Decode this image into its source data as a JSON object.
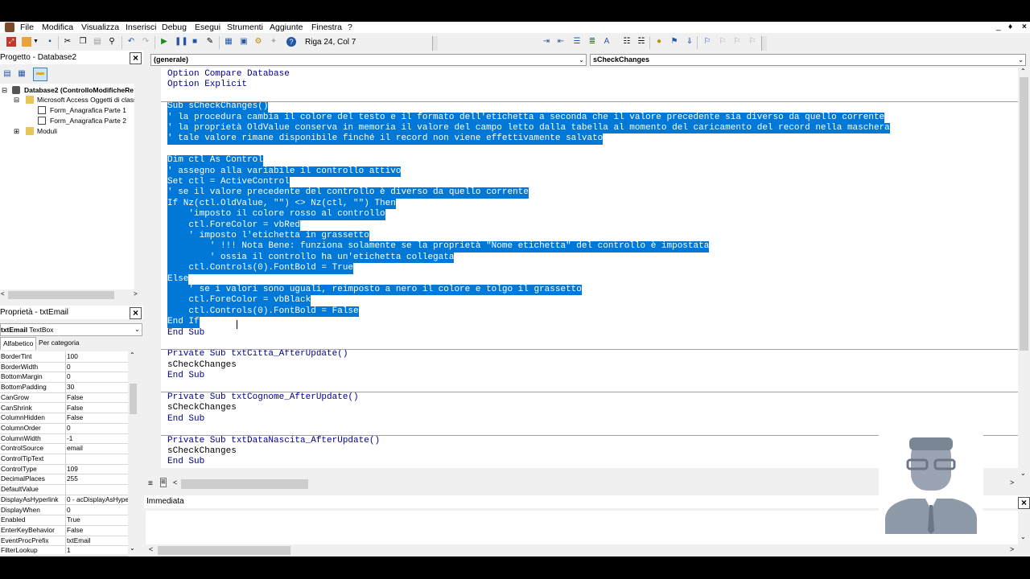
{
  "menu": [
    "File",
    "Modifica",
    "Visualizza",
    "Inserisci",
    "Debug",
    "Esegui",
    "Strumenti",
    "Aggiunte",
    "Finestra",
    "?"
  ],
  "window_controls": [
    "_",
    "♦",
    "×"
  ],
  "toolbar": {
    "position_label": "Riga 24, Col 7"
  },
  "project_pane": {
    "title": "Progetto - Database2",
    "root": "Database2 (ControlloModificheRe",
    "group": "Microsoft Access Oggetti di classe",
    "forms": [
      "Form_Anagrafica Parte 1",
      "Form_Anagrafica Parte 2"
    ],
    "modules": "Moduli"
  },
  "props_pane": {
    "title": "Proprietà - txtEmail",
    "object_name": "txtEmail",
    "object_type": "TextBox",
    "tabs": [
      "Alfabetico",
      "Per categoria"
    ],
    "rows": [
      [
        "BorderTint",
        "100"
      ],
      [
        "BorderWidth",
        "0"
      ],
      [
        "BottomMargin",
        "0"
      ],
      [
        "BottomPadding",
        "30"
      ],
      [
        "CanGrow",
        "False"
      ],
      [
        "CanShrink",
        "False"
      ],
      [
        "ColumnHidden",
        "False"
      ],
      [
        "ColumnOrder",
        "0"
      ],
      [
        "ColumnWidth",
        "-1"
      ],
      [
        "ControlSource",
        "email"
      ],
      [
        "ControlTipText",
        ""
      ],
      [
        "ControlType",
        "109"
      ],
      [
        "DecimalPlaces",
        "255"
      ],
      [
        "DefaultValue",
        ""
      ],
      [
        "DisplayAsHyperlink",
        "0 - acDisplayAsHype"
      ],
      [
        "DisplayWhen",
        "0"
      ],
      [
        "Enabled",
        "True"
      ],
      [
        "EnterKeyBehavior",
        "False"
      ],
      [
        "EventProcPrefix",
        "txtEmail"
      ],
      [
        "FilterLookup",
        "1"
      ]
    ]
  },
  "code": {
    "object_combo": "(generale)",
    "proc_combo": "sCheckChanges",
    "lines": [
      "Option Compare Database",
      "Option Explicit",
      "",
      "Sub sCheckChanges()",
      "' la procedura cambia il colore del testo e il formato dell'etichetta a seconda che il valore precedente sia diverso da quello corrente",
      "' la proprietà OldValue conserva in memoria il valore del campo letto dalla tabella al momento del caricamento del record nella maschera",
      "' tale valore rimane disponibile finché il record non viene effettivamente salvato",
      "",
      "Dim ctl As Control",
      "' assegno alla variabile il controllo attivo",
      "Set ctl = ActiveControl",
      "' se il valore precedente del controllo è diverso da quello corrente",
      "If Nz(ctl.OldValue, \"\") <> Nz(ctl, \"\") Then",
      "    'imposto il colore rosso al controllo",
      "    ctl.ForeColor = vbRed",
      "    ' imposto l'etichetta in grassetto",
      "        ' !!! Nota Bene: funziona solamente se la proprietà \"Nome etichetta\" del controllo è impostata",
      "        ' ossia il controllo ha un'etichetta collegata",
      "    ctl.Controls(0).FontBold = True",
      "Else",
      "    ' se i valori sono uguali, reimposto a nero il colore e tolgo il grassetto",
      "    ctl.ForeColor = vbBlack",
      "    ctl.Controls(0).FontBold = False",
      "End If",
      "End Sub",
      "",
      "Private Sub txtCitta_AfterUpdate()",
      "sCheckChanges",
      "End Sub",
      "",
      "Private Sub txtCognome_AfterUpdate()",
      "sCheckChanges",
      "End Sub",
      "",
      "Private Sub txtDataNascita_AfterUpdate()",
      "sCheckChanges",
      "End Sub"
    ]
  },
  "immediate": {
    "title": "Immediata"
  },
  "colors": {
    "selection": "#0078d7",
    "keyword": "#00008b"
  }
}
